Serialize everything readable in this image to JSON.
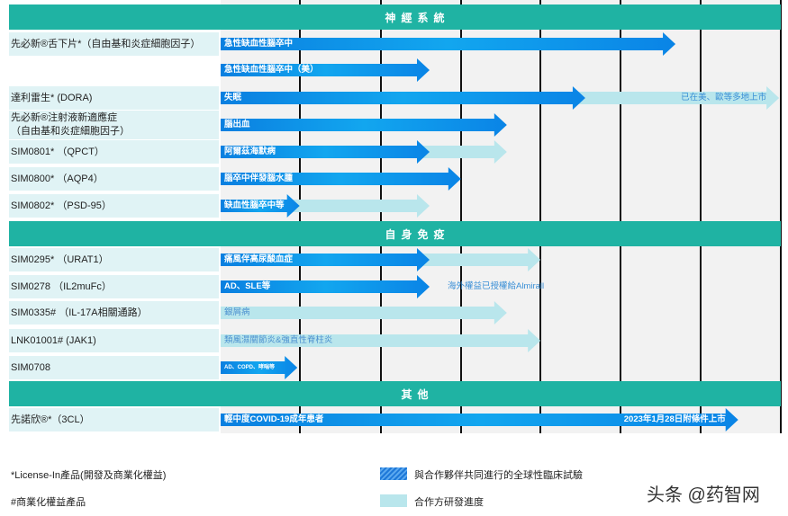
{
  "sections": [
    {
      "title": "神經系統",
      "rows": [
        {
          "label": [
            "先必新®舌下片*（自由基和炎症細胞因子）"
          ],
          "indication": "急性缺血性腦卒中",
          "dark_progress": 0.812,
          "light_progress": null
        },
        {
          "label": [],
          "indication": "急性缺血性腦卒中（美）",
          "dark_progress": 0.373,
          "light_progress": null
        },
        {
          "label": [
            "達利雷生* (DORA)"
          ],
          "indication": "失眠",
          "dark_progress": 0.651,
          "light_progress": 0.997,
          "note": "已在美、歐等多地上市",
          "note_style": "light-right"
        },
        {
          "label": [
            "先必新®注射液新適應症",
            "（自由基和炎症細胞因子）"
          ],
          "indication": "腦出血",
          "dark_progress": 0.511,
          "light_progress": null
        },
        {
          "label": [
            "SIM0801* （QPCT）"
          ],
          "indication": "阿爾茲海默病",
          "dark_progress": 0.373,
          "light_progress": 0.511
        },
        {
          "label": [
            "SIM0800* （AQP4）"
          ],
          "indication": "腦卒中伴發腦水腫",
          "dark_progress": 0.429,
          "light_progress": null
        },
        {
          "label": [
            "SIM0802* （PSD-95）"
          ],
          "indication": "缺血性腦卒中等",
          "dark_progress": 0.141,
          "light_progress": 0.373
        }
      ]
    },
    {
      "title": "自身免疫",
      "rows": [
        {
          "label": [
            "SIM0295* （URAT1）"
          ],
          "indication": "痛風伴高尿酸血症",
          "dark_progress": 0.373,
          "light_progress": 0.571
        },
        {
          "label": [
            "SIM0278 （IL2muFc）"
          ],
          "indication": "AD、SLE等",
          "dark_progress": 0.373,
          "light_progress": null,
          "note": "海外權益已授權給Almirall",
          "note_style": "after"
        },
        {
          "label": [
            "SIM0335# （IL-17A相關通路）"
          ],
          "indication": "銀屑病",
          "dark_progress": null,
          "light_progress": 0.511
        },
        {
          "label": [
            "LNK01001# (JAK1)"
          ],
          "indication": "類風濕關節炎&強直性脊柱炎",
          "dark_progress": null,
          "light_progress": 0.571
        },
        {
          "label": [
            "SIM0708"
          ],
          "indication": "AD、COPD、哮喘等",
          "dark_progress": 0.137,
          "light_progress": null,
          "small": true
        }
      ]
    },
    {
      "title": "其他",
      "rows": [
        {
          "label": [
            "先諾欣®*（3CL）"
          ],
          "indication": "輕中度COVID-19成年患者",
          "dark_progress": 0.924,
          "light_progress": null,
          "note": "2023年1月28日附條件上市",
          "note_style": "dark-right"
        }
      ]
    }
  ],
  "footnotes": [
    "*License-In產品(開發及商業化權益)",
    "#商業化權益產品"
  ],
  "legend": [
    "與合作夥伴共同進行的全球性臨床試驗",
    "合作方研發進度"
  ],
  "watermark": "头条 @药智网",
  "colors": {
    "header": "#1fb3a3",
    "dark_arrow": "#0a84e6",
    "light_arrow": "#b9e6ec",
    "label_bg": "#e0f3f5"
  }
}
